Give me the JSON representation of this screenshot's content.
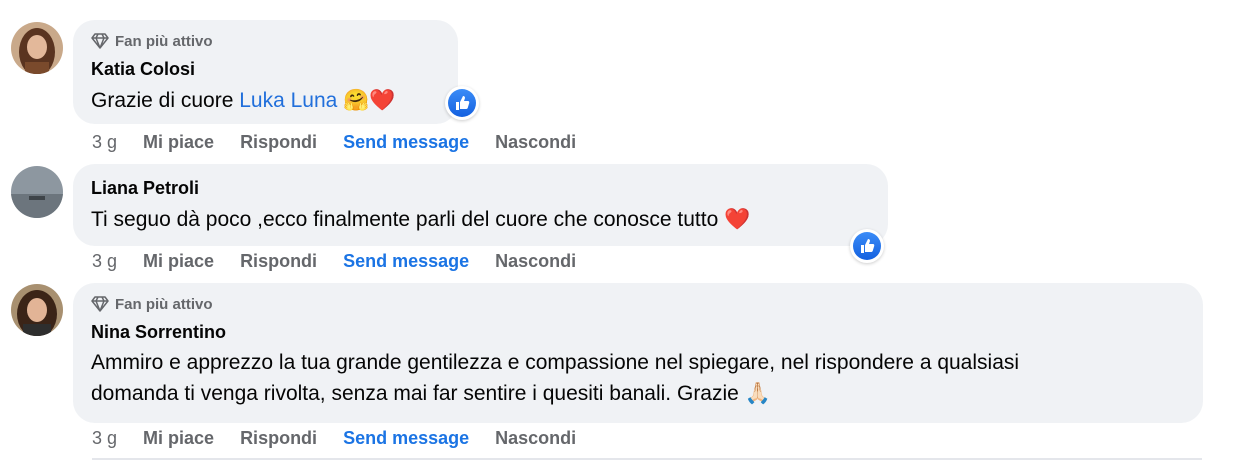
{
  "comments": [
    {
      "badge": "Fan più attivo",
      "author": "Katia Colosi",
      "text": "Grazie di cuore ",
      "mention": "Luka Luna",
      "emojis": "🤗❤️",
      "time": "3 g",
      "like": "Mi piace",
      "reply": "Rispondi",
      "send": "Send message",
      "hide": "Nascondi"
    },
    {
      "author": "Liana Petroli",
      "text": "Ti seguo dà poco ,ecco finalmente parli del cuore che conosce tutto ",
      "emojis": "❤️",
      "time": "3 g",
      "like": "Mi piace",
      "reply": "Rispondi",
      "send": "Send message",
      "hide": "Nascondi"
    },
    {
      "badge": "Fan più attivo",
      "author": "Nina Sorrentino",
      "text_line1": "Ammiro e apprezzo la tua grande gentilezza e compassione nel spiegare, nel rispondere a qualsiasi",
      "text_line2": "domanda ti venga rivolta, senza mai far sentire i quesiti banali. Grazie ",
      "emojis": "🙏🏻",
      "time": "3 g",
      "like": "Mi piace",
      "reply": "Rispondi",
      "send": "Send message",
      "hide": "Nascondi"
    }
  ],
  "colors": {
    "bubble": "#f0f2f5",
    "link": "#1b74e4",
    "meta": "#65676b"
  }
}
